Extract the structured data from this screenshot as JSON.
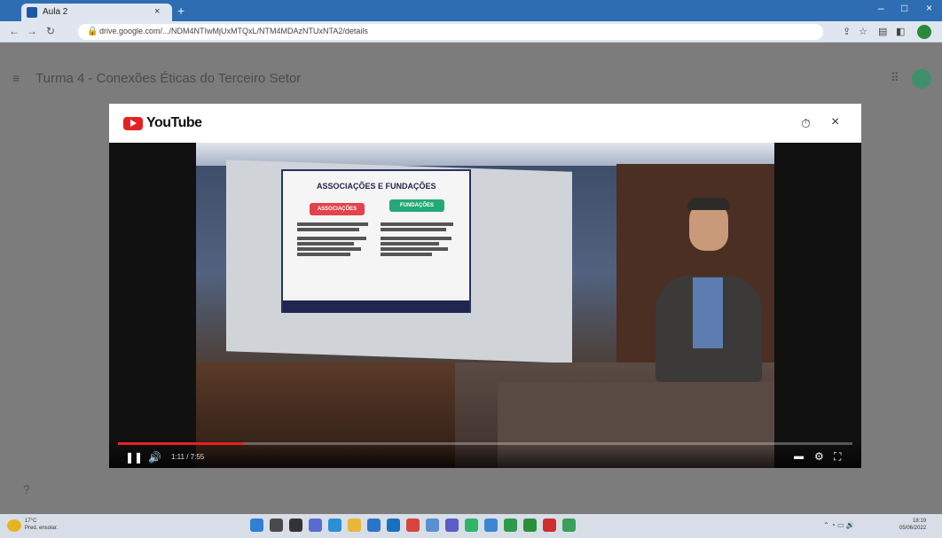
{
  "browser": {
    "tab_title": "Aula 2",
    "tab_close": "×",
    "new_tab": "+",
    "url": "drive.google.com/.../NDM4NTIwMjUxMTQxL/NTM4MDAzNTUxNTA2/details",
    "window_controls": {
      "minimize": "–",
      "maximize": "□",
      "close": "×"
    }
  },
  "classroom": {
    "menu_glyph": "≡",
    "title": "Turma 4 - Conexões Éticas do Terceiro Setor",
    "apps_glyph": "⠿",
    "help_glyph": "?"
  },
  "modal": {
    "brand": "YouTube",
    "history_glyph": "⏱",
    "close_glyph": "×",
    "slide": {
      "title": "ASSOCIAÇÕES E FUNDAÇÕES",
      "left_heading": "ASSOCIAÇÕES",
      "right_heading": "FUNDAÇÕES"
    },
    "player": {
      "play_glyph": "❚❚",
      "volume_glyph": "🔊",
      "time": "1:11 / 7:55",
      "progress_fraction": 0.17,
      "captions_glyph": "▬",
      "settings_glyph": "⚙",
      "fullscreen_glyph": "⛶"
    }
  },
  "taskbar": {
    "weather": "17°C",
    "weather_desc": "Pred. ensolar.",
    "time": "18:19",
    "date": "05/06/2022",
    "apps": [
      {
        "name": "start",
        "color": "#2f7fd4"
      },
      {
        "name": "search",
        "color": "#4a4a4a"
      },
      {
        "name": "task-view",
        "color": "#333333"
      },
      {
        "name": "chat",
        "color": "#5a6bd0"
      },
      {
        "name": "edge",
        "color": "#2a8fd4"
      },
      {
        "name": "explorer",
        "color": "#e8b735"
      },
      {
        "name": "store",
        "color": "#2a75c9"
      },
      {
        "name": "mail",
        "color": "#1b6fc2"
      },
      {
        "name": "office",
        "color": "#d8443a"
      },
      {
        "name": "photos",
        "color": "#5a8fd0"
      },
      {
        "name": "teams",
        "color": "#5d5bc8"
      },
      {
        "name": "whatsapp",
        "color": "#2fb46a"
      },
      {
        "name": "calendar",
        "color": "#3e86d0"
      },
      {
        "name": "chrome",
        "color": "#2e9a4a"
      },
      {
        "name": "spotify",
        "color": "#2a8f3a"
      },
      {
        "name": "acrobat",
        "color": "#cf2e2e"
      },
      {
        "name": "chrome-2",
        "color": "#3aa05a"
      }
    ]
  }
}
